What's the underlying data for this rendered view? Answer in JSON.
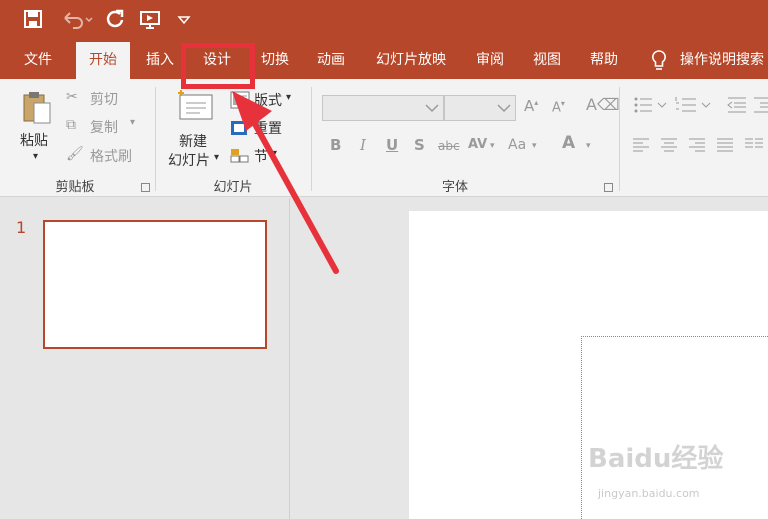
{
  "tabs": [
    {
      "label": "文件"
    },
    {
      "label": "开始"
    },
    {
      "label": "插入"
    },
    {
      "label": "设计"
    },
    {
      "label": "切换"
    },
    {
      "label": "动画"
    },
    {
      "label": "幻灯片放映"
    },
    {
      "label": "审阅"
    },
    {
      "label": "视图"
    },
    {
      "label": "帮助"
    }
  ],
  "tell_me": {
    "label": "操作说明搜索"
  },
  "clipboard": {
    "paste_label": "粘贴",
    "cut_label": "剪切",
    "copy_label": "复制",
    "format_painter_label": "格式刷",
    "group_label": "剪贴板"
  },
  "slides_group": {
    "new_slide_line1": "新建",
    "new_slide_line2": "幻灯片",
    "layout_label": "版式",
    "reset_label": "重置",
    "section_label": "节",
    "group_label": "幻灯片"
  },
  "font_group": {
    "group_label": "字体"
  },
  "slide_panel": {
    "slide_number": "1"
  },
  "watermark": {
    "brand": "Baidu经验",
    "url": "jingyan.baidu.com"
  },
  "colors": {
    "accent": "#b7472a",
    "highlight": "#e8323b"
  }
}
